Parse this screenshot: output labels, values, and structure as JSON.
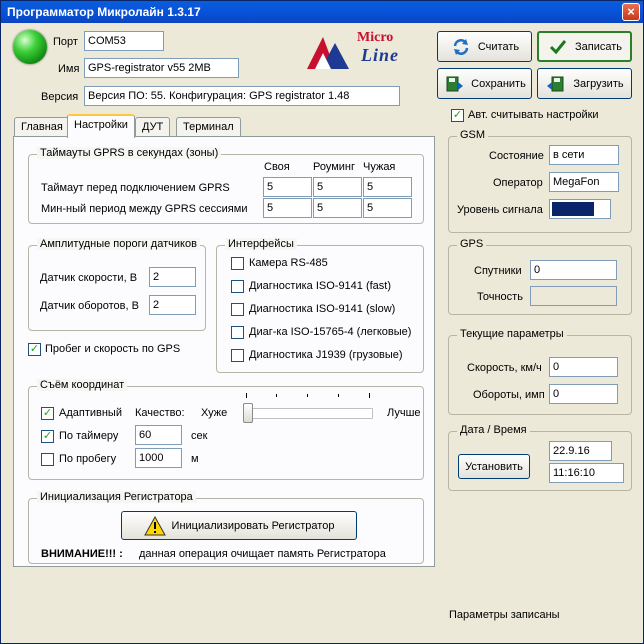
{
  "window": {
    "title": "Программатор Микролайн 1.3.17",
    "close_glyph": "×"
  },
  "connection": {
    "status_icon": "green-orb-icon",
    "port_label": "Порт",
    "port_value": "COM53",
    "name_label": "Имя",
    "name_value": "GPS-registrator v55 2MB",
    "version_label": "Версия",
    "version_value": "Версия ПО: 55. Конфигурация: GPS registrator 1.48"
  },
  "logo": {
    "line1": "Micro",
    "line2": "Line"
  },
  "toolbar": {
    "read_label": "Считать",
    "write_label": "Записать",
    "save_label": "Сохранить",
    "load_label": "Загрузить"
  },
  "auto_read": {
    "label": "Авт. считывать настройки",
    "checked": true
  },
  "tabs": [
    {
      "label": "Главная",
      "active": false
    },
    {
      "label": "Настройки",
      "active": true
    },
    {
      "label": "ДУТ",
      "active": false
    },
    {
      "label": "Терминал",
      "active": false
    }
  ],
  "gprs": {
    "title": "Таймауты GPRS в секундах (зоны)",
    "col_own": "Своя",
    "col_roaming": "Роуминг",
    "col_foreign": "Чужая",
    "row1_label": "Таймаут перед подключением GPRS",
    "row1": [
      "5",
      "5",
      "5"
    ],
    "row2_label": "Мин-ный период между GPRS сессиями",
    "row2": [
      "5",
      "5",
      "5"
    ]
  },
  "thresholds": {
    "title": "Амплитудные пороги датчиков",
    "speed_label": "Датчик скорости, В",
    "speed_value": "2",
    "rpm_label": "Датчик оборотов, В",
    "rpm_value": "2"
  },
  "interfaces": {
    "title": "Интерфейсы",
    "items": [
      {
        "label": "Камера RS-485",
        "checked": false
      },
      {
        "label": "Диагностика ISO-9141 (fast)",
        "checked": false
      },
      {
        "label": "Диагностика ISO-9141 (slow)",
        "checked": false
      },
      {
        "label": "Диаг-ка ISO-15765-4 (легковые)",
        "checked": false
      },
      {
        "label": "Диагностика J1939 (грузовые)",
        "checked": false
      }
    ]
  },
  "mileage": {
    "label": "Пробег и скорость по GPS",
    "checked": true
  },
  "coords": {
    "title": "Съём координат",
    "adaptive_label": "Адаптивный",
    "adaptive_checked": true,
    "quality_label": "Качество:",
    "worse_label": "Хуже",
    "better_label": "Лучше",
    "quality_level": 0,
    "timer_label": "По таймеру",
    "timer_checked": true,
    "timer_value": "60",
    "timer_unit": "сек",
    "distance_label": "По пробегу",
    "distance_checked": false,
    "distance_value": "1000",
    "distance_unit": "м"
  },
  "init": {
    "title": "Инициализация Регистратора",
    "button_label": "Инициализировать Регистратор",
    "warning_icon": "warning-triangle-icon",
    "warning_bold": "ВНИМАНИЕ!!! :",
    "warning_text": "данная операция очищает память Регистратора"
  },
  "gsm": {
    "title": "GSM",
    "state_label": "Состояние",
    "state_value": "в сети",
    "operator_label": "Оператор",
    "operator_value": "MegaFon",
    "signal_label": "Уровень сигнала",
    "signal_level": 0.75,
    "signal_color": "#0a246a"
  },
  "gps": {
    "title": "GPS",
    "satellites_label": "Спутники",
    "satellites_value": "0",
    "accuracy_label": "Точность",
    "accuracy_value": ""
  },
  "current": {
    "title": "Текущие параметры",
    "speed_label": "Скорость, км/ч",
    "speed_value": "0",
    "rpm_label": "Обороты, имп",
    "rpm_value": "0"
  },
  "datetime": {
    "title": "Дата / Время",
    "set_label": "Установить",
    "date_value": "22.9.16",
    "time_value": "11:16:10"
  },
  "status": {
    "text": "Параметры записаны"
  }
}
